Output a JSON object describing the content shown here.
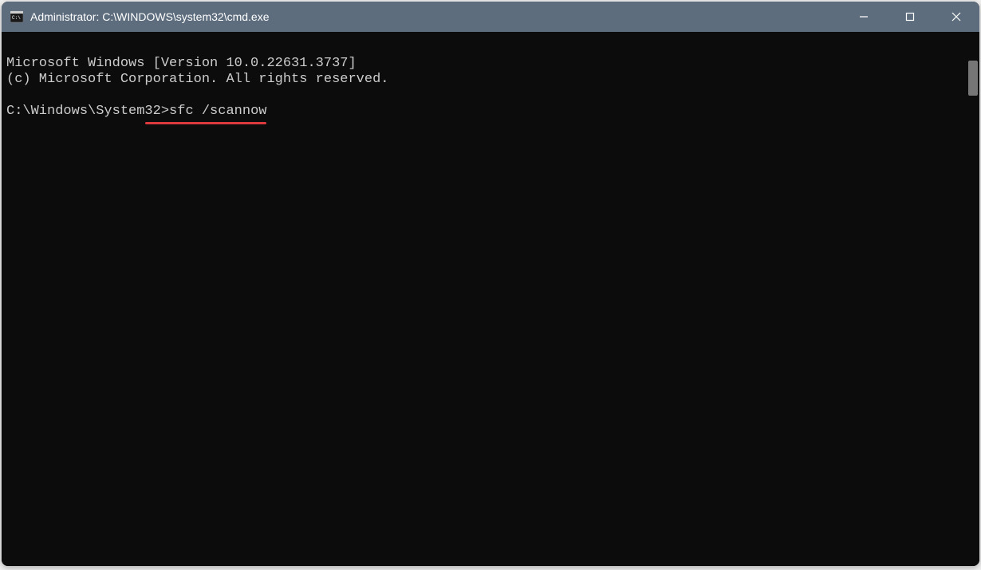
{
  "window": {
    "title": "Administrator: C:\\WINDOWS\\system32\\cmd.exe"
  },
  "terminal": {
    "line1": "Microsoft Windows [Version 10.0.22631.3737]",
    "line2": "(c) Microsoft Corporation. All rights reserved.",
    "prompt_path": "C:\\Windows\\System32>",
    "command": "sfc /scannow"
  },
  "annotation": {
    "underline_color": "#dc3a3e"
  },
  "colors": {
    "titlebar_bg": "#5d6d7e",
    "terminal_bg": "#0c0c0c",
    "terminal_fg": "#cccccc"
  }
}
